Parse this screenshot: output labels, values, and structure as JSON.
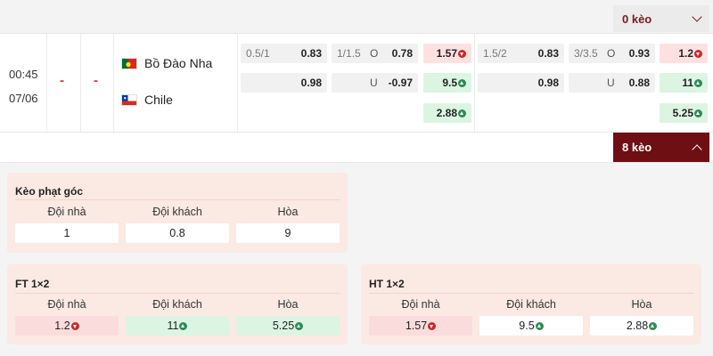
{
  "top_bar": {
    "keo_label": "0 kèo"
  },
  "match": {
    "time": "00:45",
    "date": "07/06",
    "score_home": "-",
    "score_away": "-",
    "home_team": "Bồ Đào Nha",
    "away_team": "Chile",
    "ft": {
      "handicap": {
        "line": "0.5/1",
        "home": "0.83",
        "away": "0.98"
      },
      "over_under": {
        "line": "1/1.5",
        "over_label": "O",
        "over": "0.78",
        "under_label": "U",
        "under": "-0.97"
      },
      "x12": {
        "home": "1.57",
        "away": "9.5",
        "draw": "2.88"
      }
    },
    "ht": {
      "handicap": {
        "line": "1.5/2",
        "home": "0.83",
        "away": "0.98"
      },
      "over_under": {
        "line": "3/3.5",
        "over_label": "O",
        "over": "0.93",
        "under_label": "U",
        "under": "0.88"
      },
      "x12": {
        "home": "1.2",
        "away": "11",
        "draw": "5.25"
      }
    }
  },
  "expand_bar": {
    "keo_label": "8 kèo"
  },
  "corner_card": {
    "title": "Kèo phạt góc",
    "headers": [
      "Đội nhà",
      "Đội khách",
      "Hòa"
    ],
    "values": [
      "1",
      "0.8",
      "9"
    ]
  },
  "ft_card": {
    "title": "FT 1×2",
    "headers": [
      "Đội nhà",
      "Đội khách",
      "Hòa"
    ],
    "values": [
      "1.2",
      "11",
      "5.25"
    ]
  },
  "ht_card": {
    "title": "HT 1×2",
    "headers": [
      "Đội nhà",
      "Đội khách",
      "Hòa"
    ],
    "values": [
      "1.57",
      "9.5",
      "2.88"
    ]
  },
  "colors": {
    "dark_red": "#6e0f14",
    "odds_down_bg": "#fde1e1",
    "odds_up_bg": "#dcf5e3",
    "card_bg": "#fbe9e3"
  }
}
